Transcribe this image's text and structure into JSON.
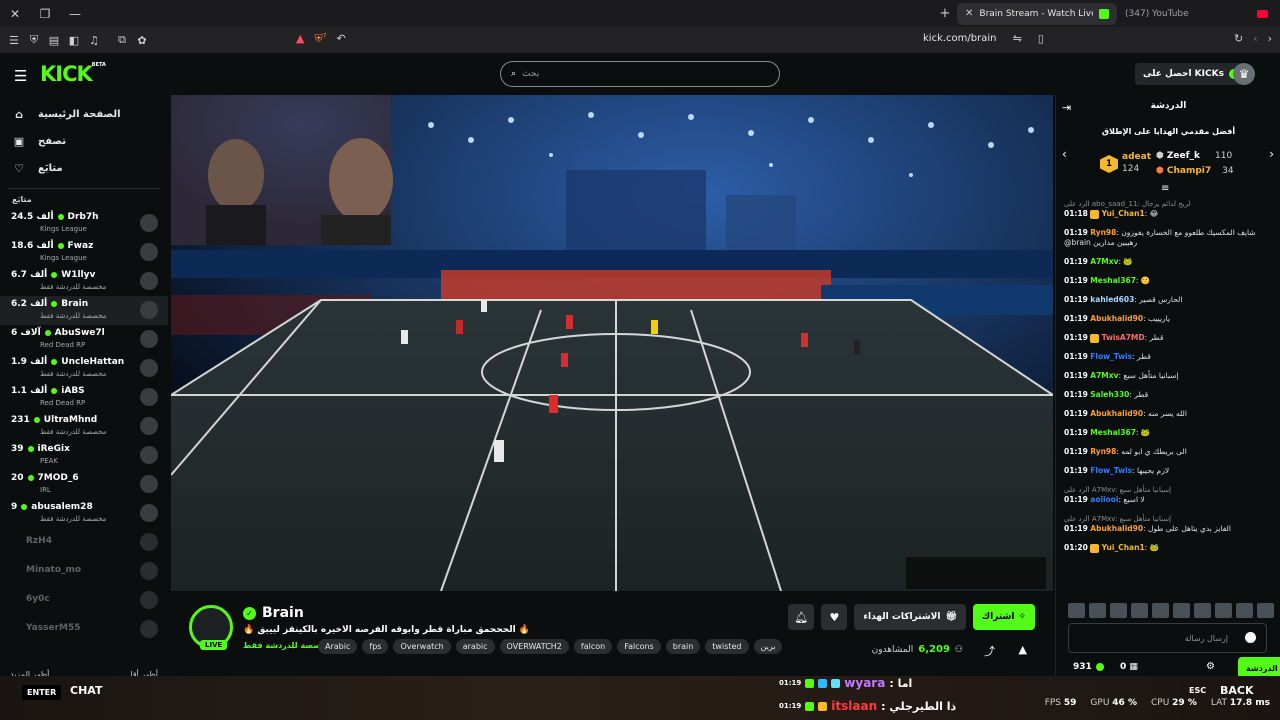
{
  "browser": {
    "tabs": [
      {
        "title": "Brain Stream - Watch Live on",
        "active": true
      },
      {
        "title": "(347) YouTube",
        "active": false
      }
    ],
    "url": "kick.com/brain",
    "shield_count": "7"
  },
  "header": {
    "logo": "KICK",
    "logo_sup": "BETA",
    "search_placeholder": "بحث",
    "get_kicks": "احصل على KICKs"
  },
  "sidebar": {
    "nav": [
      {
        "label": "الصفحة الرئيسية",
        "icon": "home-icon"
      },
      {
        "label": "تصفح",
        "icon": "browse-icon"
      },
      {
        "label": "متابَع",
        "icon": "heart-icon"
      }
    ],
    "following_title": "متابَع",
    "channels": [
      {
        "count": "24.5 ألف",
        "name": "Drb7h",
        "category": "Kings League"
      },
      {
        "count": "18.6 ألف",
        "name": "Fwaz",
        "category": "Kings League"
      },
      {
        "count": "6.7 ألف",
        "name": "W1llyv",
        "category": "مخصصة للدردشة فقط"
      },
      {
        "count": "6.2 ألف",
        "name": "Brain",
        "category": "مخصصة للدردشة فقط"
      },
      {
        "count": "6 آلاف",
        "name": "AbuSwe7l",
        "category": "Red Dead RP"
      },
      {
        "count": "1.9 ألف",
        "name": "UncleHattan",
        "category": "مخصصة للدردشة فقط"
      },
      {
        "count": "1.1 ألف",
        "name": "iABS",
        "category": "Red Dead RP"
      },
      {
        "count": "231",
        "name": "UltraMhnd",
        "category": "مخصصة للدردشة فقط"
      },
      {
        "count": "39",
        "name": "iReGix",
        "category": "PEAK"
      },
      {
        "count": "20",
        "name": "7MOD_6",
        "category": "IRL"
      },
      {
        "count": "9",
        "name": "abusalem28",
        "category": "مخصصة للدردشة فقط"
      }
    ],
    "offline": [
      "RzH4",
      "Minato_mo",
      "6y0c",
      "YasserM55"
    ],
    "show_more": "أظهر المزيد",
    "show_less": "أظهر أقل"
  },
  "stream": {
    "streamer": "Brain",
    "live": "LIVE",
    "title": "🔥 الحححمق مباراة قطر وابوقه الفرصه الاخيره بالكينقز ليييق 🔥",
    "category": "مخصصة للدردشة فقط",
    "tags": [
      "Arabic",
      "fps",
      "Overwatch",
      "arabic",
      "OVERWATCH2",
      "falcon",
      "Falcons",
      "brain",
      "twisted",
      "برين"
    ],
    "subscribe": "اشتراك",
    "gift_subs": "الاشتراكات الهداء",
    "viewers_label": "المشاهدون",
    "viewers": "6,209"
  },
  "chat": {
    "title": "الدردشة",
    "leaderboard_title": "أفضل مقدمي الهدايا على الإطلاق",
    "leaderboard": [
      {
        "name": "adeat",
        "amount": "124",
        "color": "#f5b82e"
      },
      {
        "name": "Zeef_k",
        "amount": "110",
        "color": "#ffffff"
      },
      {
        "name": "Champi7",
        "amount": "34",
        "color": "#f5b82e"
      }
    ],
    "messages": [
      {
        "reply": "الرد على abo_saad_11: لربح لدائم يرجال",
        "time": "01:18",
        "user": "Yui_Chan1",
        "color": "#f5b82e",
        "text": "😂",
        "badge": true
      },
      {
        "time": "01:19",
        "user": "Ryn98",
        "color": "#ff9d2f",
        "text": "شايف المكسيك طلعوو مع الخسارة يفوزون @brain رهيبين مدارين"
      },
      {
        "time": "01:19",
        "user": "A7Mxv",
        "color": "#53fc18",
        "text": "🐸"
      },
      {
        "time": "01:19",
        "user": "Meshal367",
        "color": "#53fc18",
        "text": "🙂"
      },
      {
        "time": "01:19",
        "user": "kahled603",
        "color": "#a8d8ff",
        "text": "الحارس قصير"
      },
      {
        "time": "01:19",
        "user": "Abukhalid90",
        "color": "#ff9d2f",
        "text": "ياريييب"
      },
      {
        "time": "01:19",
        "user": "TwisA7MD",
        "color": "#ff6b6b",
        "text": "قطر",
        "badge": true
      },
      {
        "time": "01:19",
        "user": "Flow_Twis",
        "color": "#2f7dff",
        "text": "قطر"
      },
      {
        "time": "01:19",
        "user": "A7Mxv",
        "color": "#53fc18",
        "text": "إسبانيا متأهل سبع"
      },
      {
        "time": "01:19",
        "user": "Saleh330",
        "color": "#53fc18",
        "text": "قطر"
      },
      {
        "time": "01:19",
        "user": "Abukhalid90",
        "color": "#ff9d2f",
        "text": "الله يسر منه"
      },
      {
        "time": "01:19",
        "user": "Meshal367",
        "color": "#53fc18",
        "text": "🐸"
      },
      {
        "time": "01:19",
        "user": "Ryn98",
        "color": "#ff9d2f",
        "text": "الى بريطك ي ابو لمه"
      },
      {
        "time": "01:19",
        "user": "Flow_Twis",
        "color": "#2f7dff",
        "text": "لازم يجيبها"
      },
      {
        "reply": "الرد على A7Mxv: إسبانيا متأهل سبع",
        "time": "01:19",
        "user": "aoiiooi",
        "color": "#2f7dff",
        "text": "لا اسبع"
      },
      {
        "reply": "الرد على A7Mxv: إسبانيا متأهل سبع",
        "time": "01:19",
        "user": "Abukhalid90",
        "color": "#ff9d2f",
        "text": "الفايز بدي يتاهل على طول"
      },
      {
        "time": "01:20",
        "user": "Yui_Chan1",
        "color": "#f5b82e",
        "text": "🐸",
        "badge": true
      }
    ],
    "input_placeholder": "إرسال رسالة",
    "points": "931",
    "gifts": "0",
    "send_label": "الدردشة"
  },
  "overlay": {
    "enter": "ENTER",
    "chat": "CHAT",
    "messages": [
      {
        "time": "01:19",
        "user": "wyara",
        "user_color": "#c07bff",
        "text": ": اما"
      },
      {
        "time": "01:19",
        "user": "itslaan",
        "user_color": "#ff3b3b",
        "text": ": ذا الطيرجلي"
      }
    ],
    "esc": "ESC",
    "back": "BACK",
    "stats": [
      {
        "label": "FPS",
        "value": "59"
      },
      {
        "label": "GPU",
        "value": "46 %"
      },
      {
        "label": "CPU",
        "value": "29 %"
      },
      {
        "label": "LAT",
        "value": "17.8 ms"
      }
    ]
  },
  "colors": {
    "accent": "#53fc18",
    "bg": "#0b0e0f"
  }
}
